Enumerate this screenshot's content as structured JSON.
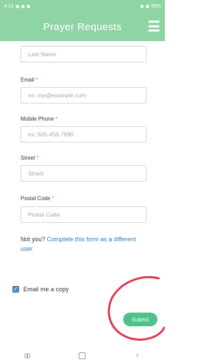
{
  "status_bar": {
    "time": "4:23",
    "battery": "65%"
  },
  "app_bar": {
    "title": "Prayer Requests",
    "menu_icon": "hamburger-menu-icon"
  },
  "form": {
    "last_name": {
      "placeholder": "Last Name",
      "value": ""
    },
    "email": {
      "label": "Email",
      "required": "*",
      "placeholder": "ex: me@example.com",
      "value": ""
    },
    "mobile_phone": {
      "label": "Mobile Phone",
      "required": "*",
      "placeholder": "ex: 555-456-7890",
      "value": ""
    },
    "street": {
      "label": "Street",
      "required": "*",
      "placeholder": "Street",
      "value": ""
    },
    "postal_code": {
      "label": "Postal Code",
      "required": "*",
      "placeholder": "Postal Code",
      "value": ""
    },
    "not_you_text": "Not you?",
    "complete_link": "Complete this form as a different user.",
    "email_copy_label": "Email me a copy",
    "email_copy_checked": true,
    "submit_label": "Submit"
  },
  "colors": {
    "header": "#8fd4a4",
    "submit": "#4cc489",
    "link": "#2a7cc7",
    "required": "#e05a6f",
    "annotation_circle": "#e0344a",
    "checkbox": "#4a88c7"
  },
  "nav_bar": {
    "recents_icon": "recent-apps-icon",
    "home_icon": "home-icon",
    "back_icon": "back-icon"
  }
}
